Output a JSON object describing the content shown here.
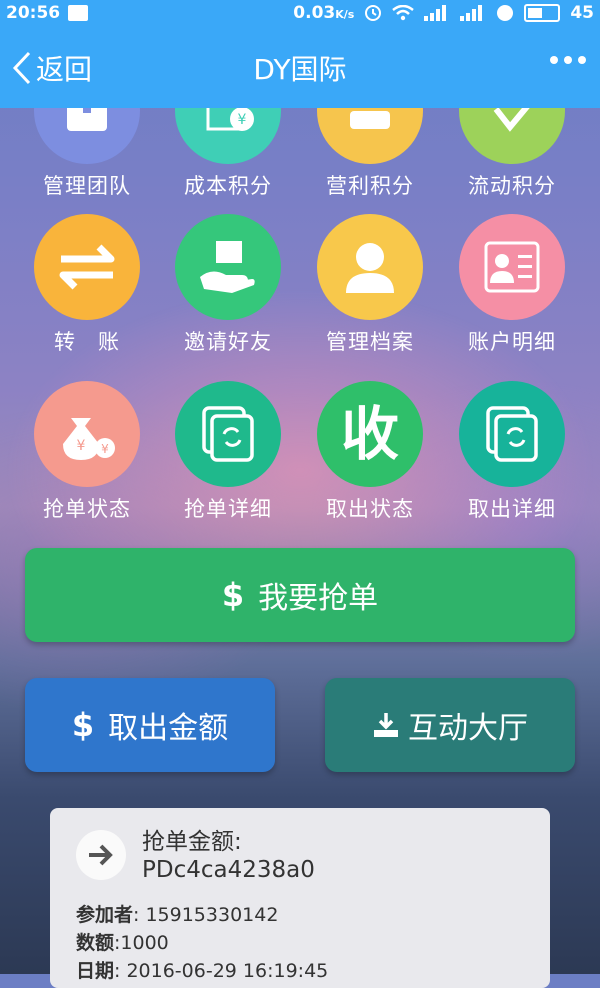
{
  "status_bar": {
    "time": "20:56",
    "network_speed": "0.03",
    "speed_unit": "K/s",
    "battery": "45"
  },
  "nav": {
    "back_label": "返回",
    "title": "DY国际"
  },
  "grid": {
    "items": [
      {
        "label": "管理团队",
        "color": "#7d8ee0",
        "icon": "team-icon"
      },
      {
        "label": "成本积分",
        "color": "#3fcfb6",
        "icon": "cost-points-icon"
      },
      {
        "label": "营利积分",
        "color": "#f6c54d",
        "icon": "profit-points-icon"
      },
      {
        "label": "流动积分",
        "color": "#9dd25a",
        "icon": "flow-points-icon"
      },
      {
        "label": "转　账",
        "color": "#f9b43b",
        "icon": "transfer-icon"
      },
      {
        "label": "邀请好友",
        "color": "#35c77b",
        "icon": "invite-friend-icon"
      },
      {
        "label": "管理档案",
        "color": "#f8c84b",
        "icon": "profile-icon"
      },
      {
        "label": "账户明细",
        "color": "#f58fa5",
        "icon": "account-detail-icon"
      },
      {
        "label": "抢单状态",
        "color": "#f59a8e",
        "icon": "money-bag-icon"
      },
      {
        "label": "抢单详细",
        "color": "#1fb98c",
        "icon": "order-detail-icon"
      },
      {
        "label": "取出状态",
        "color": "#2fbf6a",
        "icon": "withdraw-status-icon",
        "glyph": "收"
      },
      {
        "label": "取出详细",
        "color": "#17b39a",
        "icon": "withdraw-detail-icon"
      }
    ]
  },
  "buttons": {
    "grab_order": {
      "icon": "$",
      "label": "我要抢单",
      "color": "#2fb36a"
    },
    "withdraw": {
      "icon": "$",
      "label": "取出金额",
      "color": "#2f76cc"
    },
    "hall": {
      "label": "互动大厅",
      "color": "#2a7c78"
    }
  },
  "card": {
    "title_label": "抢单金额:",
    "order_id": "PDc4ca4238a0",
    "participant_label": "参加者",
    "participant_value": ": 15915330142",
    "amount_label": "数额",
    "amount_value": ":1000",
    "date_label": "日期",
    "date_value": ": 2016-06-29 16:19:45"
  }
}
